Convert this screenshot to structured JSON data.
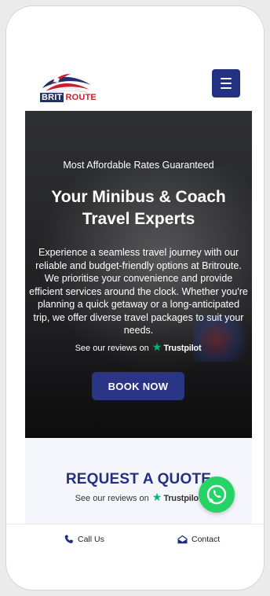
{
  "header": {
    "logo": {
      "brit": "BRIT",
      "route": "ROUTE"
    },
    "menu_icon": "menu-icon"
  },
  "hero": {
    "subtitle": "Most Affordable Rates Guaranteed",
    "title": "Your Minibus & Coach Travel Experts",
    "body": "Experience a seamless travel journey with our reliable and budget-friendly options at Britroute. We prioritise your convenience and provide efficient services around the clock. Whether you're planning a quick getaway or a long-anticipated trip, we offer diverse travel packages to suit your needs.",
    "reviews_text": "See our reviews on",
    "trustpilot": "Trustpilot",
    "cta": "BOOK NOW"
  },
  "quote": {
    "title": "REQUEST A QUOTE",
    "reviews_text": "See our reviews on",
    "trustpilot": "Trustpilot"
  },
  "bottom_bar": {
    "call": "Call Us",
    "contact": "Contact"
  },
  "colors": {
    "brand_navy": "#233184",
    "brand_red": "#c81f2d",
    "trustpilot_green": "#00b67a",
    "whatsapp_green": "#25d366"
  },
  "icons": [
    "menu-icon",
    "trustpilot-star-icon",
    "whatsapp-icon",
    "phone-icon",
    "envelope-icon"
  ]
}
